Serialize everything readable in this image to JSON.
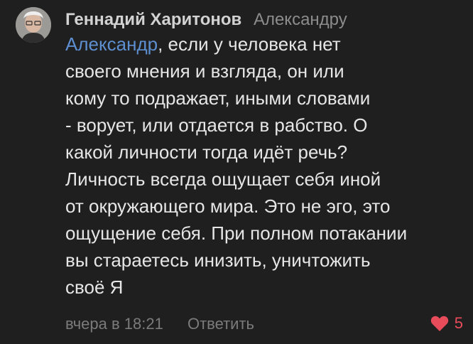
{
  "comment": {
    "author": "Геннадий Харитонов",
    "reply_to": "Александру",
    "mention": "Александр",
    "text_after_mention": ", если у человека нет\nсвоего мнения и взгляда, он или\nкому то подражает, иными словами\n- ворует, или отдается в рабство. О\nкакой личности тогда идёт речь?\nЛичность всегда ощущает себя иной\nот окружающего мира. Это не эго, это\nощущение себя. При полном потакании\nвы стараетесь инизить, уничтожить\nсвоё Я",
    "timestamp": "вчера в 18:21",
    "reply_label": "Ответить",
    "likes_count": "5",
    "like_icon": "heart-icon",
    "accent_color": "#e84c5b",
    "mention_color": "#5d8fd0"
  }
}
